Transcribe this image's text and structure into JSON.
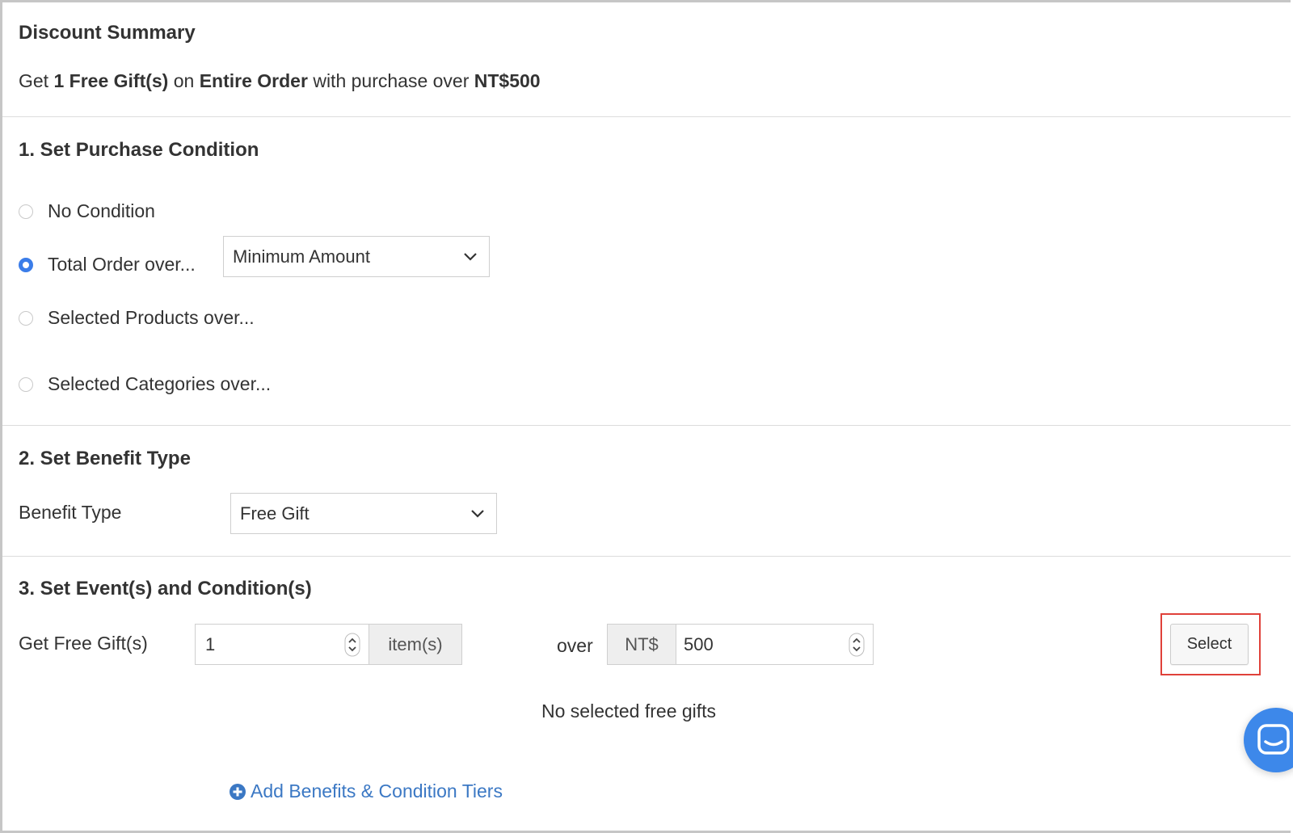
{
  "summary": {
    "title": "Discount Summary",
    "line_prefix": "Get ",
    "gift_count": "1 Free Gift(s)",
    "on": " on ",
    "scope": "Entire Order",
    "with_purchase": " with purchase over ",
    "amount": "NT$500"
  },
  "condition": {
    "title": "1. Set Purchase Condition",
    "options": [
      {
        "label": "No Condition",
        "checked": false
      },
      {
        "label": "Total Order over...",
        "checked": true
      },
      {
        "label": "Selected Products over...",
        "checked": false
      },
      {
        "label": "Selected Categories over...",
        "checked": false
      }
    ],
    "threshold_select": "Minimum Amount"
  },
  "benefit": {
    "title": "2. Set Benefit Type",
    "label": "Benefit Type",
    "select_value": "Free Gift"
  },
  "events": {
    "title": "3. Set Event(s) and Condition(s)",
    "row_label": "Get Free Gift(s)",
    "quantity": "1",
    "quantity_unit": "item(s)",
    "over_label": "over",
    "currency": "NT$",
    "amount": "500",
    "select_button": "Select",
    "empty_text": "No selected free gifts",
    "add_tiers_link": "Add Benefits & Condition Tiers"
  },
  "colors": {
    "accent": "#3b7de9",
    "link": "#3b78c4",
    "highlight": "#e0413a",
    "chat": "#3d88ea"
  }
}
